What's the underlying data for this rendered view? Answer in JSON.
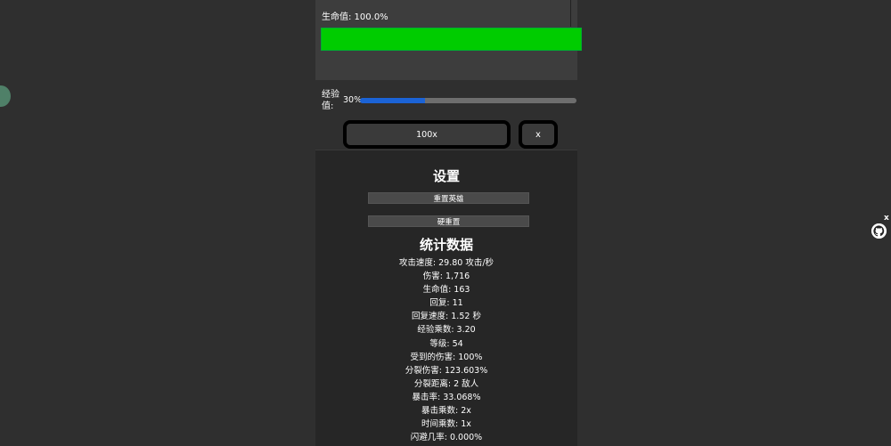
{
  "hp": {
    "label": "生命值: 100.0%",
    "fill_fraction": 1.0
  },
  "xp": {
    "label": "经验值:",
    "percent_text": "30%",
    "fill_fraction": 0.3
  },
  "controls": {
    "speed_label": "100x",
    "close_label": "x"
  },
  "settings": {
    "title": "设置",
    "reset_hero_label": "重置英雄",
    "hard_reset_label": "硬重置"
  },
  "stats": {
    "title": "统计数据",
    "lines": [
      "攻击速度: 29.80 攻击/秒",
      "伤害: 1,716",
      "生命值: 163",
      "回复: 11",
      "回复速度: 1.52 秒",
      "经验乘数: 3.20",
      "等级: 54",
      "受到的伤害: 100%",
      "分裂伤害: 123.603%",
      "分裂距离: 2 敌人",
      "暴击率: 33.068%",
      "暴击乘数: 2x",
      "时间乘数: 1x",
      "闪避几率: 0.000%"
    ]
  },
  "floating": {
    "close_label": "x",
    "icon": "github-cat-icon"
  },
  "colors": {
    "hp_fill": "#00cc00",
    "xp_fill": "#1b63d6",
    "background": "#2f2f2f"
  }
}
